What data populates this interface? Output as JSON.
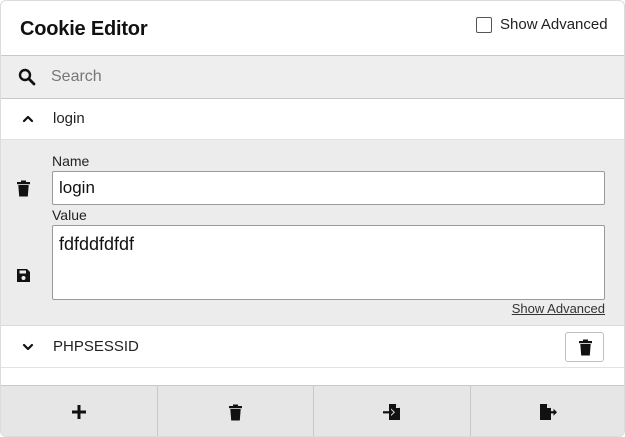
{
  "app": {
    "title": "Cookie Editor",
    "show_advanced_checkbox_label": "Show Advanced",
    "show_advanced_checked": false
  },
  "search": {
    "placeholder": "Search",
    "value": ""
  },
  "cookies": [
    {
      "name": "login",
      "expanded": true,
      "fields": {
        "name_label": "Name",
        "name_value": "login",
        "value_label": "Value",
        "value_value": "fdfddfdfdf"
      },
      "show_advanced_link": "Show Advanced"
    },
    {
      "name": "PHPSESSID",
      "expanded": false
    }
  ],
  "footer": {
    "buttons": [
      {
        "icon": "plus-icon",
        "action": "add"
      },
      {
        "icon": "trash-icon",
        "action": "delete-all"
      },
      {
        "icon": "import-icon",
        "action": "import"
      },
      {
        "icon": "export-icon",
        "action": "export"
      }
    ]
  },
  "colors": {
    "header_bg": "#ffffff",
    "search_bg": "#eeeeee",
    "details_bg": "#ececec",
    "footer_bg": "#e6e6e6",
    "border": "#c8c8c8",
    "text": "#111111"
  }
}
